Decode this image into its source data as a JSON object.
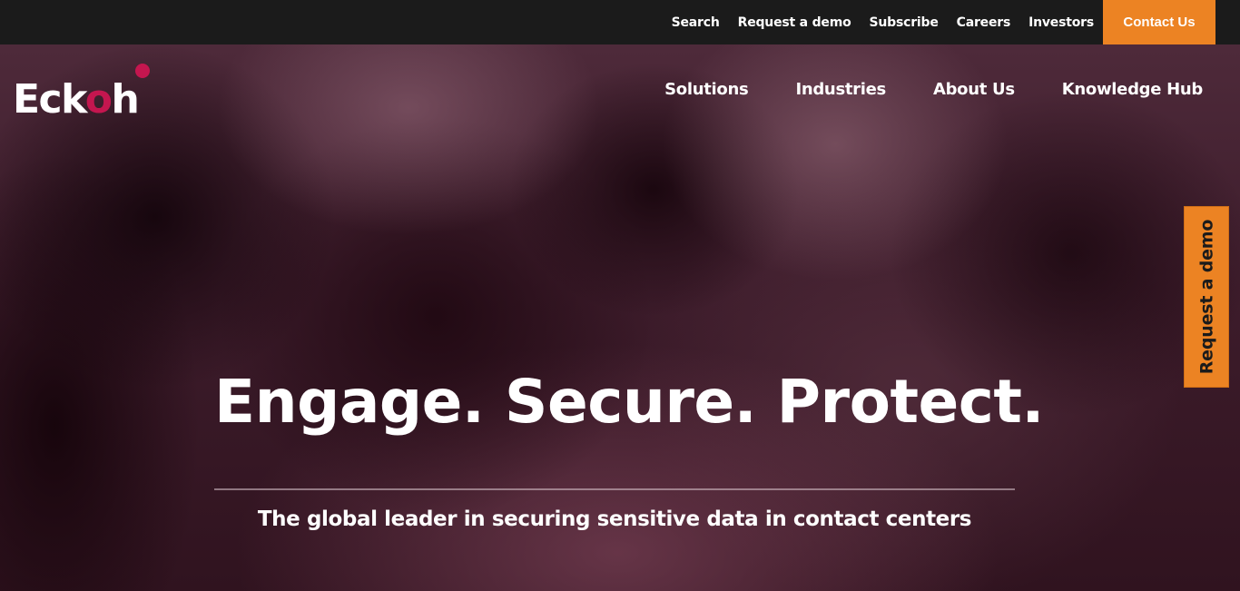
{
  "utility_nav": {
    "items": [
      {
        "label": "Search"
      },
      {
        "label": "Request a demo"
      },
      {
        "label": "Subscribe"
      },
      {
        "label": "Careers"
      },
      {
        "label": "Investors"
      }
    ],
    "contact_label": "Contact Us"
  },
  "logo": {
    "prefix": "Eck",
    "highlight": "o",
    "suffix": "h"
  },
  "main_nav": {
    "items": [
      {
        "label": "Solutions"
      },
      {
        "label": "Industries"
      },
      {
        "label": "About Us"
      },
      {
        "label": "Knowledge Hub"
      }
    ]
  },
  "side_tab": {
    "label": "Request a demo"
  },
  "hero": {
    "title": "Engage. Secure. Protect.",
    "subtitle": "The global leader in securing sensitive data in contact centers"
  },
  "colors": {
    "accent_orange": "#ec8323",
    "brand_magenta": "#c4164f",
    "utility_bar_bg": "#1b1b1b",
    "hero_bg": "#3d1c2b"
  }
}
